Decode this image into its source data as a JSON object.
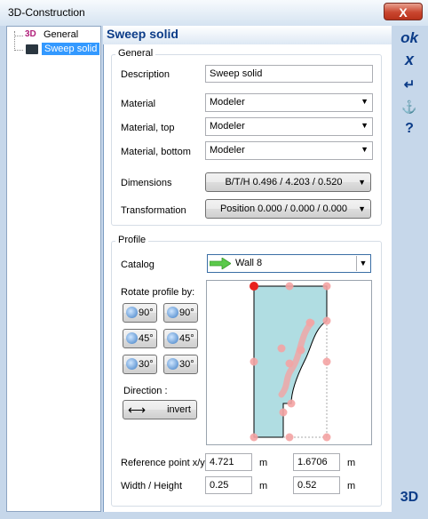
{
  "window": {
    "title": "3D-Construction",
    "close_symbol": "X"
  },
  "tree": {
    "items": [
      {
        "label": "General",
        "icon": "3d-logo-icon",
        "badge": "3D"
      },
      {
        "label": "Sweep solid",
        "icon": "sweep-solid-icon",
        "selected": true
      }
    ]
  },
  "header": {
    "title": "Sweep solid"
  },
  "right_toolbar": {
    "ok": "ok",
    "cancel": "x",
    "enter": "↵",
    "anchor": "⚓",
    "help": "?",
    "logo": "3D"
  },
  "general": {
    "legend": "General",
    "description_label": "Description",
    "description_value": "Sweep solid",
    "material_label": "Material",
    "material_value": "Modeler",
    "material_top_label": "Material, top",
    "material_top_value": "Modeler",
    "material_bottom_label": "Material, bottom",
    "material_bottom_value": "Modeler",
    "dimensions_label": "Dimensions",
    "dimensions_value": "B/T/H 0.496 / 4.203 / 0.520",
    "transformation_label": "Transformation",
    "transformation_value": "Position 0.000 / 0.000 / 0.000"
  },
  "profile": {
    "legend": "Profile",
    "catalog_label": "Catalog",
    "catalog_value": "Wall 8",
    "rotate_label": "Rotate profile by:",
    "rotations": [
      "90°",
      "90°",
      "45°",
      "45°",
      "30°",
      "30°"
    ],
    "direction_label": "Direction :",
    "invert_label": "invert",
    "refpoint_label": "Reference point x/y",
    "ref_x": "4.721",
    "ref_y": "1.6706",
    "width_height_label": "Width / Height",
    "width": "0.25",
    "height": "0.52",
    "unit": "m"
  },
  "colors": {
    "accent": "#0c3c88",
    "profile_fill": "#b0dde2",
    "point": "#f4a4a4",
    "selected_point": "#e8221e"
  }
}
